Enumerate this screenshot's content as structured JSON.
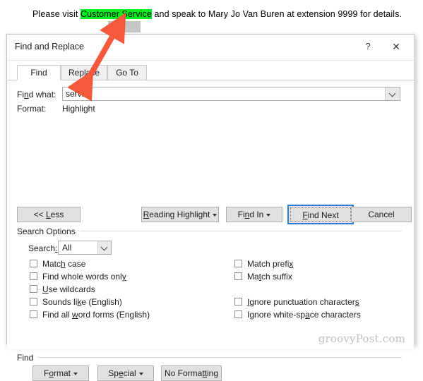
{
  "document": {
    "sentence_parts": [
      {
        "text": "Please visit ",
        "highlight": false
      },
      {
        "text": "Customer Service",
        "highlight": true
      },
      {
        "text": " and speak to Mary Jo Van Buren at extension 9999 for details.",
        "highlight": false
      }
    ],
    "full_sentence": "Please visit Customer Service and speak to Mary Jo Van Buren at extension 9999 for details.",
    "highlighted_text": "Customer Service",
    "highlight_color": "#00f11d",
    "selection_color": "#c6c6c6"
  },
  "dialog": {
    "title": "Find and Replace",
    "help_icon": "question-mark-icon",
    "close_icon": "close-x-icon",
    "tabs": [
      {
        "label": "Find",
        "active": true
      },
      {
        "label": "Replace",
        "active": false
      },
      {
        "label": "Go To",
        "active": false
      }
    ],
    "find_what": {
      "label": "Find what:",
      "value": "service",
      "placeholder": "",
      "dropdown_icon": "chevron-down-icon"
    },
    "format": {
      "label": "Format:",
      "value": "Highlight"
    },
    "actions": {
      "less": "<< Less",
      "reading_highlight": "Reading Highlight",
      "find_in": "Find In",
      "find_next": "Find Next",
      "cancel": "Cancel"
    },
    "search_options": {
      "group_label": "Search Options",
      "search_label": "Search:",
      "search_value": "All",
      "search_dropdown_icon": "chevron-down-icon",
      "left_checkboxes": [
        {
          "label": "Match case",
          "checked": false
        },
        {
          "label": "Find whole words only",
          "checked": false
        },
        {
          "label": "Use wildcards",
          "checked": false
        },
        {
          "label": "Sounds like (English)",
          "checked": false
        },
        {
          "label": "Find all word forms (English)",
          "checked": false
        }
      ],
      "right_checkboxes": [
        {
          "label": "Match prefix",
          "checked": false
        },
        {
          "label": "Match suffix",
          "checked": false
        },
        {
          "label": "Ignore punctuation characters",
          "checked": false
        },
        {
          "label": "Ignore white-space characters",
          "checked": false
        }
      ]
    },
    "find_group": {
      "group_label": "Find",
      "format_button": "Format",
      "special_button": "Special",
      "no_formatting_button": "No Formatting"
    }
  },
  "watermark": "groovyPost.com",
  "annotation": {
    "arrow_color": "#f4593c",
    "type": "double-headed-arrow"
  }
}
